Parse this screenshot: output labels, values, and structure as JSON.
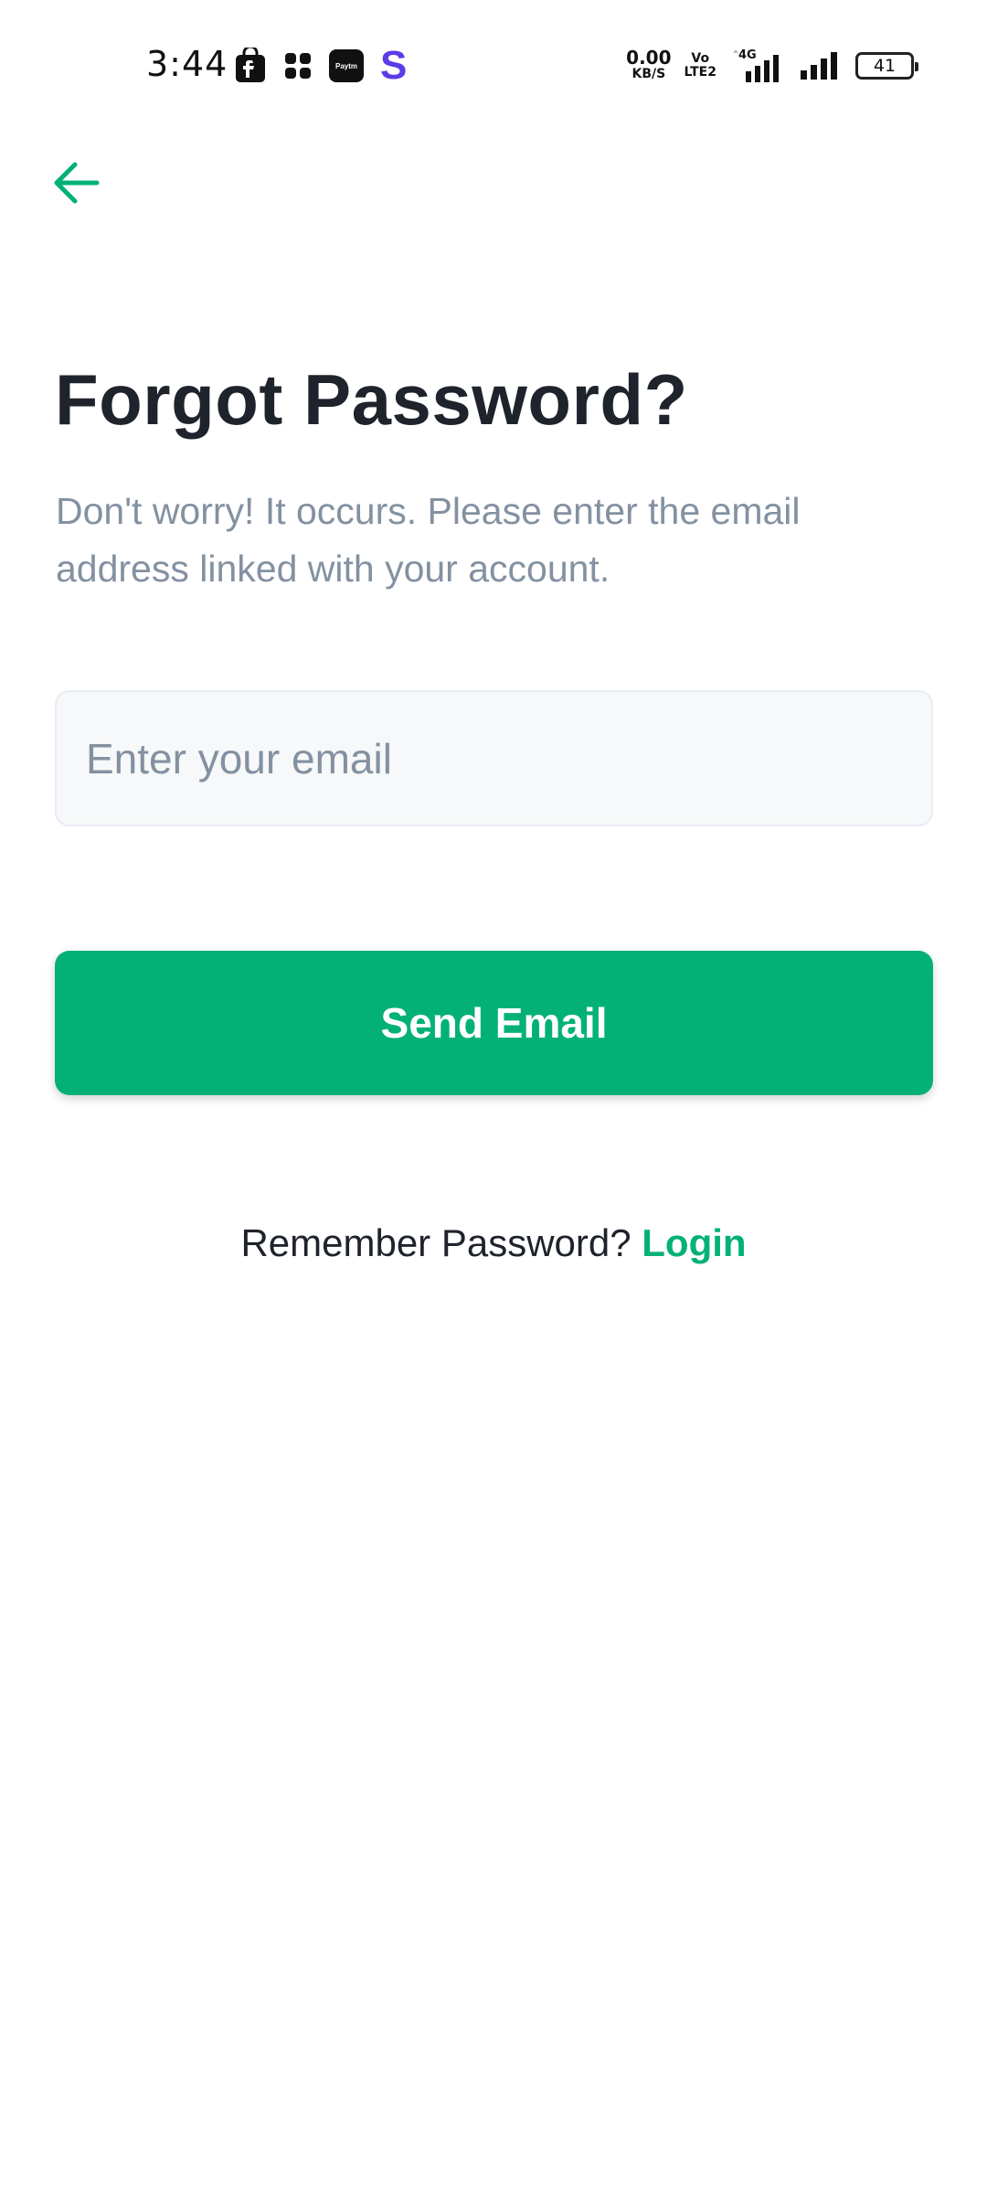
{
  "status_bar": {
    "time": "3:44",
    "net_speed_value": "0.00",
    "net_speed_unit": "KB/S",
    "volte_top": "Vo",
    "volte_bottom": "LTE2",
    "network_type": "4G",
    "battery_level": "41",
    "paytm_label": "Paytm",
    "s_app_letter": "S"
  },
  "header": {
    "back_icon": "arrow-left-icon",
    "accent_color": "#03B176"
  },
  "main": {
    "title": "Forgot Password?",
    "subtitle": "Don't worry! It occurs. Please enter the email address linked with your account.",
    "email": {
      "placeholder": "Enter your email",
      "value": ""
    },
    "send_button_label": "Send Email",
    "remember_text": "Remember Password?",
    "login_link_label": "Login"
  }
}
